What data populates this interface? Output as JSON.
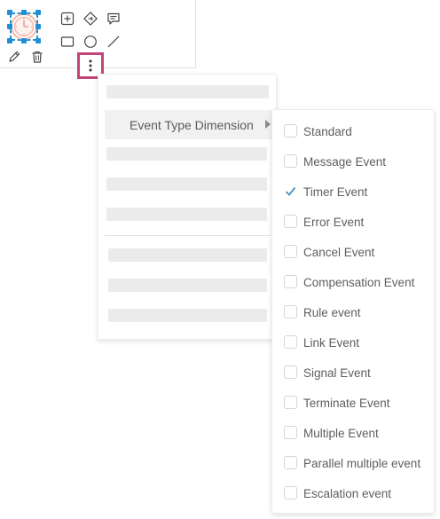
{
  "context_menu": {
    "event_type_item": {
      "label": "Event Type Dimension"
    }
  },
  "event_type_submenu": {
    "options": [
      {
        "label": "Standard",
        "checked": false
      },
      {
        "label": "Message Event",
        "checked": false
      },
      {
        "label": "Timer Event",
        "checked": true
      },
      {
        "label": "Error Event",
        "checked": false
      },
      {
        "label": "Cancel Event",
        "checked": false
      },
      {
        "label": "Compensation Event",
        "checked": false
      },
      {
        "label": "Rule event",
        "checked": false
      },
      {
        "label": "Link Event",
        "checked": false
      },
      {
        "label": "Signal Event",
        "checked": false
      },
      {
        "label": "Terminate Event",
        "checked": false
      },
      {
        "label": "Multiple Event",
        "checked": false
      },
      {
        "label": "Parallel multiple event",
        "checked": false
      },
      {
        "label": "Escalation event",
        "checked": false
      }
    ]
  },
  "icons": {
    "context_pad": [
      "plus-box-icon",
      "gateway-icon",
      "comment-icon",
      "rectangle-icon",
      "circle-icon",
      "line-icon",
      "pencil-icon",
      "trash-icon",
      "more-vertical-icon"
    ],
    "submenu": "caret-right-icon",
    "check": "checkmark-icon"
  },
  "colors": {
    "selection": "#1e8fd6",
    "highlight_border": "#c2447a",
    "timer_event": "#f3b9a9",
    "placeholder": "#ebebeb",
    "active_item_bg": "#f1f1f1",
    "check": "#4f8fbf"
  }
}
